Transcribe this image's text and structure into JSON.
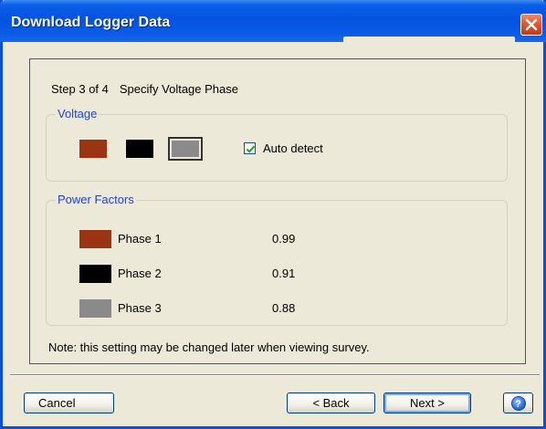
{
  "window": {
    "title": "Download Logger Data"
  },
  "step": {
    "label": "Step 3 of 4",
    "description": "Specify Voltage Phase"
  },
  "voltage": {
    "legend": "Voltage",
    "swatches": [
      {
        "color": "#9a3412"
      },
      {
        "color": "#000000"
      },
      {
        "color": "#8a8a8a",
        "selected": true
      }
    ],
    "auto_detect": {
      "label": "Auto detect",
      "checked": true
    }
  },
  "power_factors": {
    "legend": "Power Factors",
    "rows": [
      {
        "label": "Phase 1",
        "value": "0.99",
        "color": "#9a3412"
      },
      {
        "label": "Phase 2",
        "value": "0.91",
        "color": "#000000"
      },
      {
        "label": "Phase 3",
        "value": "0.88",
        "color": "#8a8a8a"
      }
    ]
  },
  "note": "Note: this setting may be changed later when viewing survey.",
  "buttons": {
    "cancel": "Cancel",
    "back": "< Back",
    "next": "Next >"
  },
  "icons": {
    "close": "close-icon",
    "help": "help-icon",
    "check": "check-icon"
  }
}
